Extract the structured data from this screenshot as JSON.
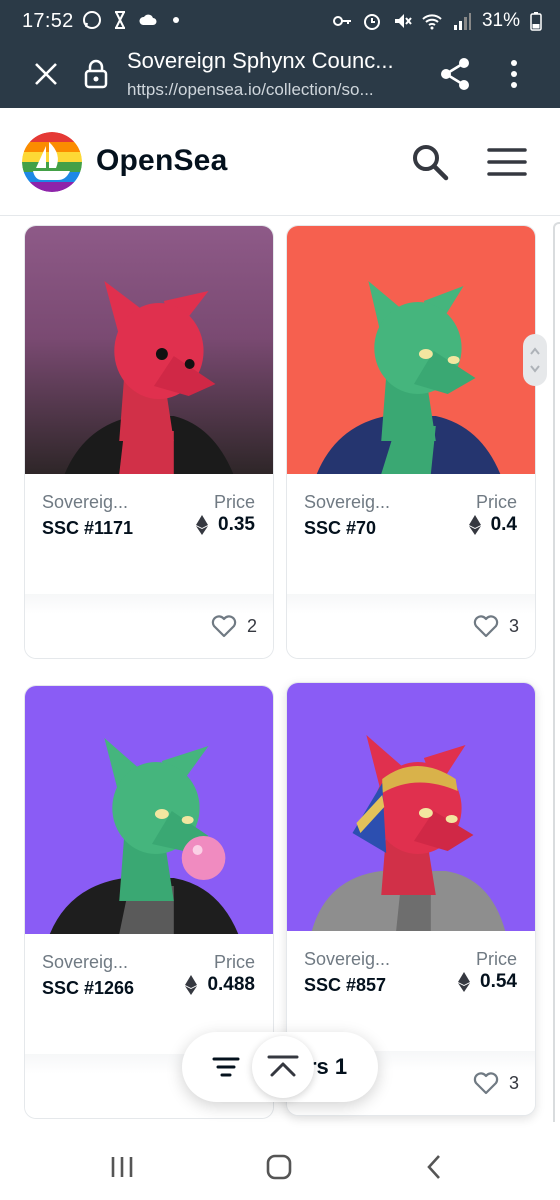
{
  "status_bar": {
    "time": "17:52",
    "battery": "31%",
    "left_icons": [
      "whatsapp-icon",
      "hourglass-icon",
      "cloud-icon",
      "dot-icon"
    ],
    "right_icons": [
      "key-icon",
      "alarm-icon",
      "mute-icon",
      "wifi-icon",
      "signal-icon",
      "battery-icon"
    ]
  },
  "browser": {
    "page_title": "Sovereign Sphynx Counc...",
    "url": "https://opensea.io/collection/so..."
  },
  "site": {
    "brand": "OpenSea"
  },
  "colors": {
    "chrome_bg": "#2b3a47",
    "text_primary": "#04111d",
    "text_secondary": "#707a83",
    "purple_bg": "#8a5cf5",
    "coral_bg": "#f6604f",
    "mauve_bg": "#8b4f86"
  },
  "cards": [
    {
      "collection": "Sovereig...",
      "name": "SSC #1171",
      "price_label": "Price",
      "price": "0.35",
      "likes": "2"
    },
    {
      "collection": "Sovereig...",
      "name": "SSC #70",
      "price_label": "Price",
      "price": "0.4",
      "likes": "3"
    },
    {
      "collection": "Sovereig...",
      "name": "SSC #1266",
      "price_label": "Price",
      "price": "0.488",
      "likes": ""
    },
    {
      "collection": "Sovereig...",
      "name": "SSC #857",
      "price_label": "Price",
      "price": "0.54",
      "likes": "3"
    }
  ],
  "filter_pill": {
    "label": "rs  1"
  }
}
